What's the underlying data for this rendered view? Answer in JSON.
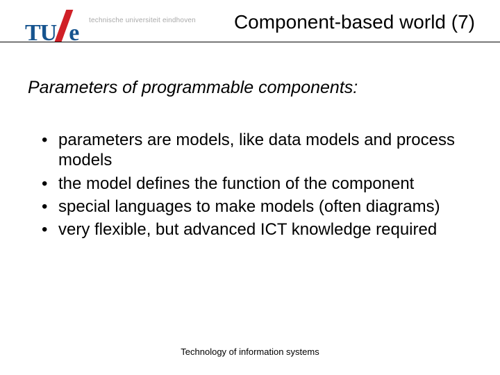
{
  "logo": {
    "tu": "TU",
    "e": "e",
    "subtitle": "technische universiteit eindhoven"
  },
  "title": "Component-based world (7)",
  "subheading": "Parameters of programmable components:",
  "bullets": [
    "parameters are models, like data models and process models",
    "the model defines the function of the component",
    "special languages to make models (often diagrams)",
    "very flexible, but advanced ICT knowledge required"
  ],
  "footer": "Technology of  information systems"
}
